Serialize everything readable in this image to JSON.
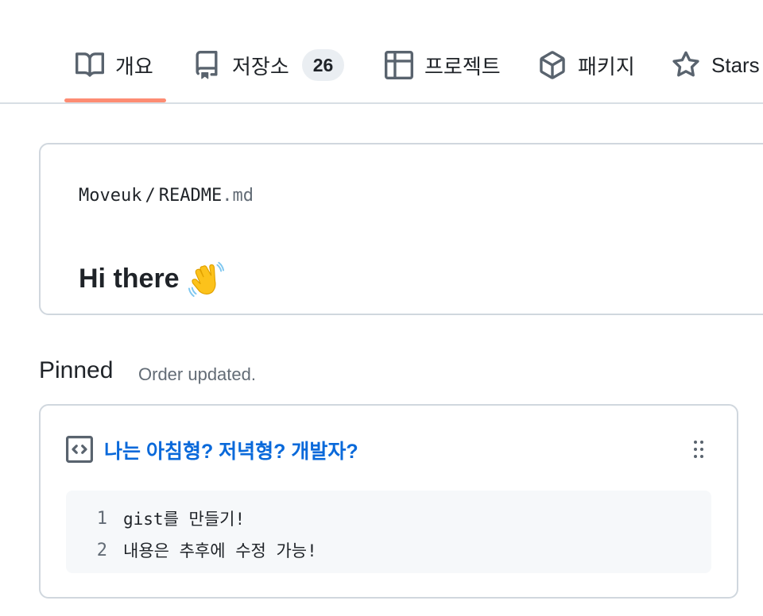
{
  "nav": {
    "tabs": [
      {
        "label": "개요",
        "icon": "book-icon",
        "active": true
      },
      {
        "label": "저장소",
        "icon": "repo-icon",
        "count": "26"
      },
      {
        "label": "프로젝트",
        "icon": "table-icon"
      },
      {
        "label": "패키지",
        "icon": "package-icon"
      },
      {
        "label": "Stars",
        "icon": "star-icon"
      }
    ],
    "active_underline_color": "#fd8c73"
  },
  "readme": {
    "owner": "Moveuk",
    "separator": "/",
    "file_name": "README",
    "file_ext": ".md",
    "heading": "Hi there",
    "heading_emoji": "waving-hand-icon"
  },
  "pinned": {
    "title": "Pinned",
    "status": "Order updated.",
    "items": [
      {
        "icon": "code-square-icon",
        "title": "나는 아침형? 저녁형? 개발자?",
        "lines": [
          {
            "number": "1",
            "text": "gist를 만들기!"
          },
          {
            "number": "2",
            "text": "내용은 추후에 수정 가능!"
          }
        ]
      }
    ]
  },
  "colors": {
    "link": "#0969da",
    "muted": "#636c76",
    "border": "#d0d7de",
    "code_bg": "#f6f8fa"
  }
}
